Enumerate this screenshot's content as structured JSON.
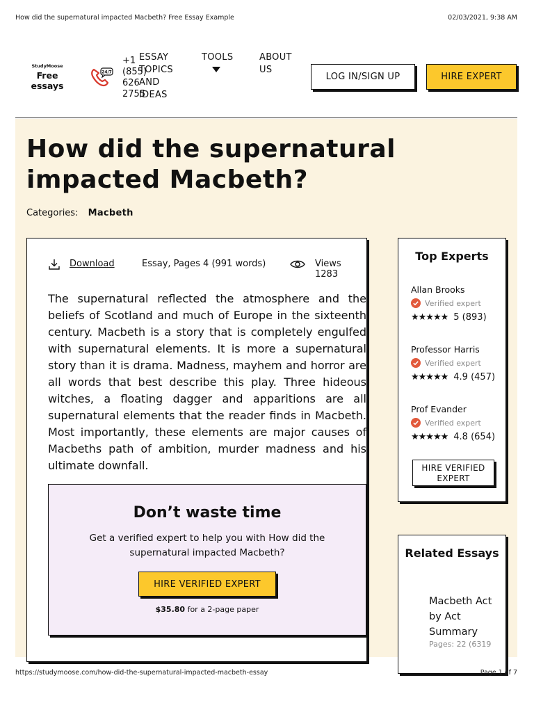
{
  "print": {
    "page_title": "How did the supernatural impacted Macbeth? Free Essay Example",
    "datetime": "02/03/2021, 9:38 AM",
    "url": "https://studymoose.com/how-did-the-supernatural-impacted-macbeth-essay",
    "page_of": "Page 1 of 7"
  },
  "nav": {
    "brand": "StudyMoose",
    "brand_sub": "Free essays",
    "phone": "+1 (855) 626 2755",
    "menu": [
      "ESSAY TOPICS AND IDEAS",
      "TOOLS",
      "ABOUT US"
    ],
    "login_label": "LOG IN/SIGN UP",
    "hire_label": "HIRE EXPERT"
  },
  "article": {
    "title": "How did the supernatural impacted Macbeth?",
    "categories_label": "Categories:",
    "category": "Macbeth",
    "download_label": "Download",
    "info": "Essay, Pages 4  (991 words)",
    "views": "Views 1283",
    "body": "The supernatural reflected the atmosphere and the beliefs of Scotland and much of Europe in the sixteenth century. Macbeth is a story that is completely engulfed with supernatural elements. It is more a supernatural story than it is drama. Madness, mayhem and horror are all words that best describe this play. Three hideous witches, a floating dagger and apparitions are all supernatural elements that the reader finds in Macbeth. Most importantly, these elements are major causes of Macbeths path of ambition, murder madness and his ultimate downfall."
  },
  "cta": {
    "heading": "Don’t waste time",
    "text": "Get a verified expert to help you with How did the supernatural impacted Macbeth?",
    "button": "HIRE VERIFIED EXPERT",
    "price": "$35.80",
    "price_suffix": " for a 2-page paper"
  },
  "experts": {
    "heading": "Top Experts",
    "list": [
      {
        "name": "Allan Brooks",
        "verified": "Verified expert",
        "rating": "5 (893)"
      },
      {
        "name": "Professor Harris",
        "verified": "Verified expert",
        "rating": "4.9 (457)"
      },
      {
        "name": "Prof Evander",
        "verified": "Verified expert",
        "rating": "4.8 (654)"
      }
    ],
    "stars": "★★★★★",
    "hire_label": "HIRE VERIFIED EXPERT"
  },
  "related": {
    "heading": "Related Essays",
    "item_title": "Macbeth Act by Act Summary",
    "item_pages": "Pages: 22 (6319"
  },
  "colors": {
    "accent_yellow": "#fcc82c",
    "hero_bg": "#fbf3e0",
    "cta_bg": "#f5ecf8",
    "verified_red": "#e25a3c"
  }
}
